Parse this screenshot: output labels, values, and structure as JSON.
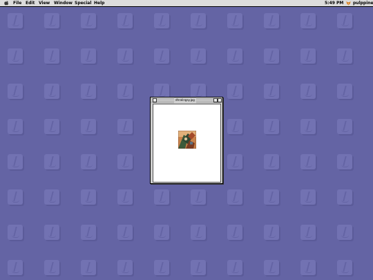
{
  "menubar": {
    "apple_icon": "apple-icon",
    "menus": [
      "File",
      "Edit",
      "View",
      "Window",
      "Special",
      "Help"
    ],
    "clock": "5:49 PM",
    "app_icon": "fox-icon",
    "app_name": "pulppine"
  },
  "window": {
    "title": "dhralingsy.jpg",
    "picture": "image-thumbnail"
  },
  "desktop": {
    "pattern_icon": "mac-face-icon",
    "background_color": "#6464a4"
  }
}
